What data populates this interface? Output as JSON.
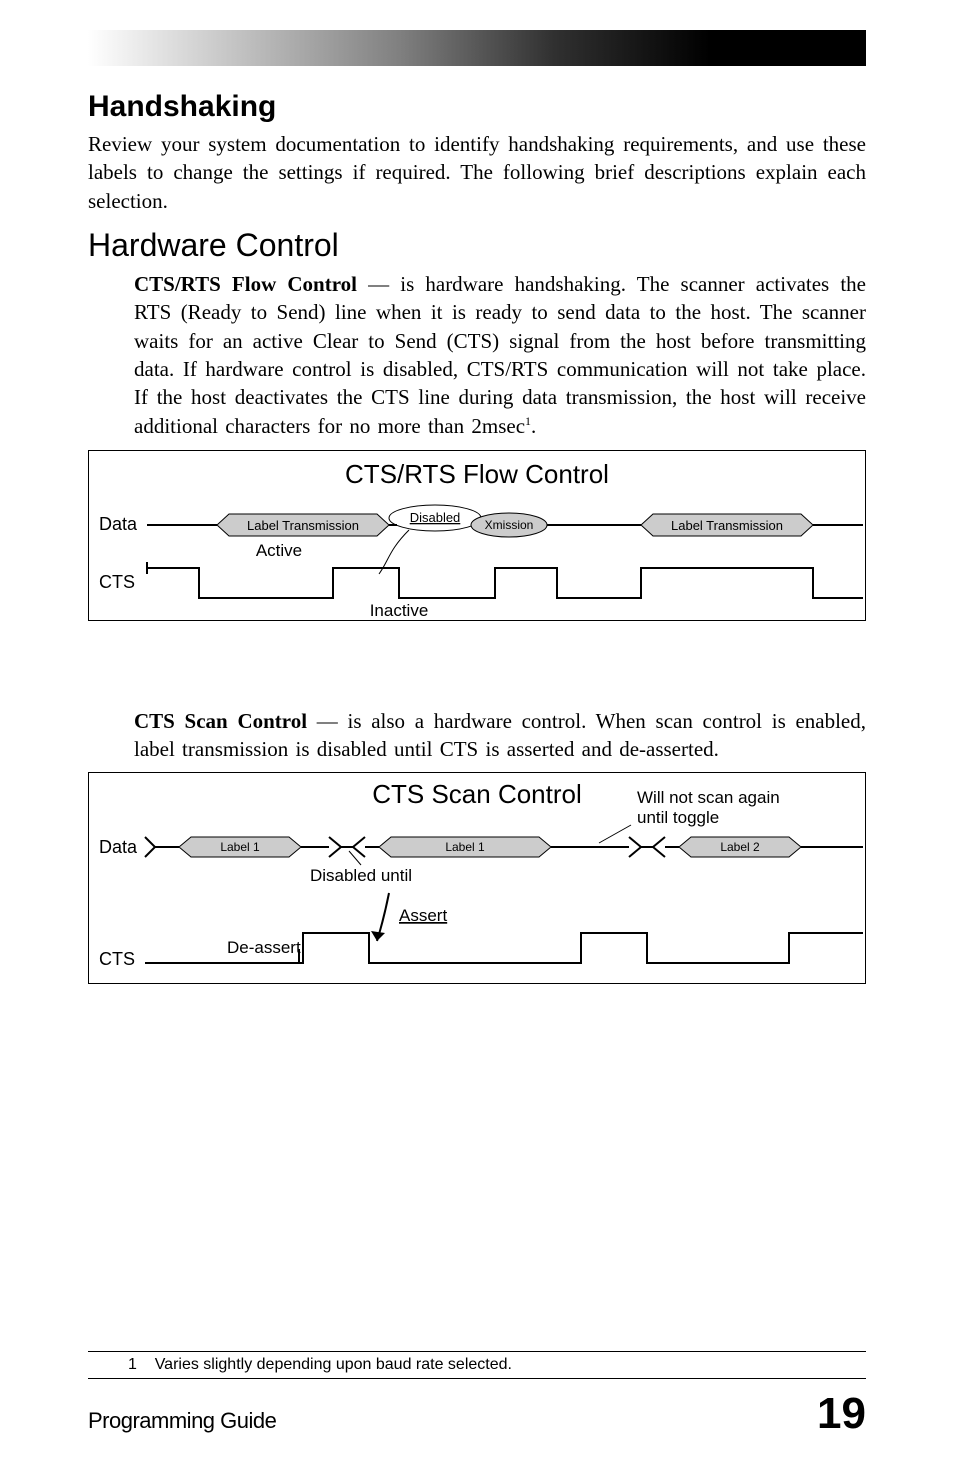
{
  "h1": "Handshaking",
  "intro": "Review your system documentation to identify handshaking requirements, and use these labels to change the settings if required.  The following brief descriptions explain each selection.",
  "h2": "Hardware Control",
  "para1": {
    "bold": "CTS/RTS Flow Control",
    "rest": "  —  is hardware handshaking.  The scanner activates the RTS (Ready to Send) line when it is ready to send data to the host.  The scanner waits for an active Clear to Send (CTS) signal from the host before transmitting data.  If hardware control is disabled, CTS/RTS communication will not take place. If the host deactivates the CTS line during data transmission, the host will receive additional characters for no more than 2msec"
  },
  "diag1": {
    "title": "CTS/RTS Flow Control",
    "data": "Data",
    "cts": "CTS",
    "lt": "Label Transmission",
    "disabled": "Disabled",
    "xmission": "Xmission",
    "active": "Active",
    "inactive": "Inactive"
  },
  "para2": {
    "bold": "CTS Scan Control",
    "rest": "  —  is also a hardware control.  When scan control is enabled, label transmission is disabled until CTS is asserted and de-asserted."
  },
  "diag2": {
    "title": "CTS Scan Control",
    "data": "Data",
    "cts": "CTS",
    "l1": "Label 1",
    "l2": "Label 2",
    "noscan": "Will not scan again until toggle",
    "disabled_until": "Disabled until",
    "assert": "Assert",
    "deassert": "De-assert"
  },
  "footnote": {
    "num": "1",
    "text": "Varies slightly depending upon baud rate selected."
  },
  "footer": {
    "left": "Programming Guide",
    "right": "19"
  }
}
